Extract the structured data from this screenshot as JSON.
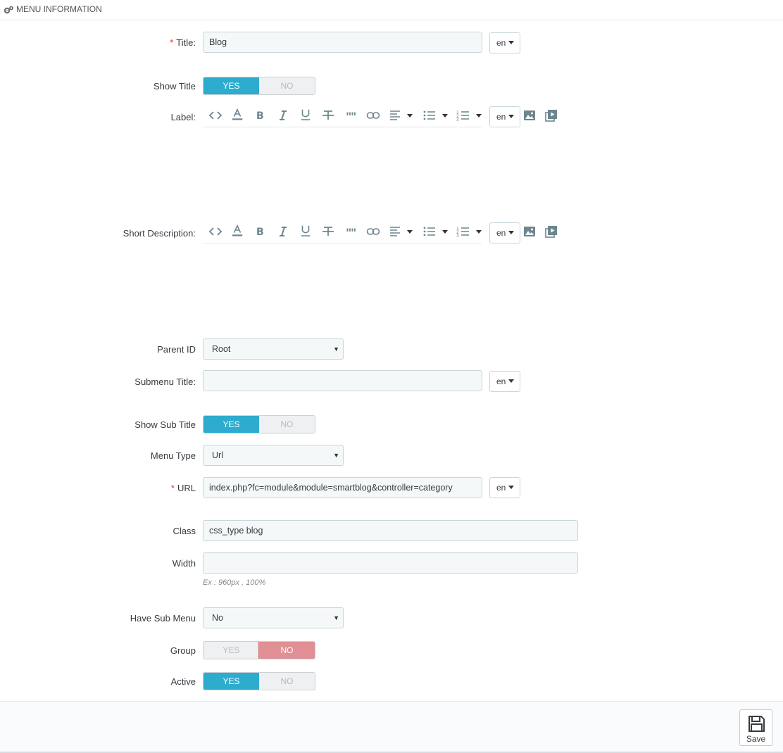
{
  "header": {
    "title": "MENU INFORMATION",
    "icon": "cogs-icon"
  },
  "fields": {
    "title": {
      "label": "Title:",
      "required": "*",
      "value": "Blog",
      "lang": "en"
    },
    "show_title": {
      "label": "Show Title",
      "yes": "YES",
      "no": "NO",
      "selected": "YES"
    },
    "label": {
      "label": "Label:",
      "lang": "en"
    },
    "short_description": {
      "label": "Short Description:",
      "lang": "en"
    },
    "parent_id": {
      "label": "Parent ID",
      "value": "Root"
    },
    "submenu_title": {
      "label": "Submenu Title:",
      "value": "",
      "lang": "en"
    },
    "show_sub_title": {
      "label": "Show Sub Title",
      "yes": "YES",
      "no": "NO",
      "selected": "YES"
    },
    "menu_type": {
      "label": "Menu Type",
      "value": "Url"
    },
    "url": {
      "label": "URL",
      "required": "*",
      "value": "index.php?fc=module&module=smartblog&controller=category",
      "lang": "en"
    },
    "class": {
      "label": "Class",
      "value": "css_type blog"
    },
    "width": {
      "label": "Width",
      "value": "",
      "hint": "Ex : 960px , 100%"
    },
    "have_sub_menu": {
      "label": "Have Sub Menu",
      "value": "No"
    },
    "group": {
      "label": "Group",
      "yes": "YES",
      "no": "NO",
      "selected": "NO"
    },
    "active": {
      "label": "Active",
      "yes": "YES",
      "no": "NO",
      "selected": "YES"
    }
  },
  "editor_toolbar": {
    "buttons": [
      "code-view-icon",
      "font-color-icon",
      "bold-icon",
      "italic-icon",
      "underline-icon",
      "strikethrough-icon",
      "quote-icon",
      "link-icon",
      "align-icon",
      "unordered-list-icon",
      "ordered-list-icon",
      "image-icon",
      "video-icon"
    ]
  },
  "footer": {
    "save_label": "Save"
  },
  "colors": {
    "yes_active": "#2eacce",
    "no_active": "#e08f95",
    "required": "#e02a2a"
  }
}
